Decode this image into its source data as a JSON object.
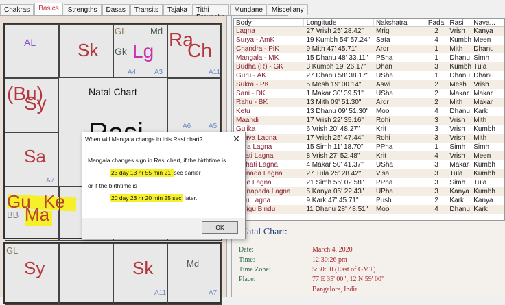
{
  "tabs": [
    "Chakras",
    "Basics",
    "Strengths",
    "Dasas",
    "Transits",
    "Tajaka",
    "Tithi Pravesha",
    "Mundane",
    "Miscellany"
  ],
  "selected_tab": "Basics",
  "rasi_chart": {
    "title": "Natal Chart",
    "name": "Rasi",
    "cells": {
      "r0c0": {
        "AL": "AL"
      },
      "r0c1": {
        "Sk": "Sk"
      },
      "r0c2": {
        "GL": "GL",
        "Md": "Md",
        "Gk": "Gk",
        "Lg": "Lg",
        "A4": "A4",
        "A3": "A3"
      },
      "r0c3": {
        "Ra": "Ra",
        "Ch": "Ch",
        "A11": "A11"
      },
      "r1c0": {
        "Bu": "(Bu)",
        "Sy": "Sy"
      },
      "r1c3": {
        "A6": "A6",
        "A5": "A5"
      },
      "r2c0": {
        "Sa": "Sa",
        "A7": "A7"
      },
      "r3c0": {
        "Gu": "Gu",
        "Ke": "Ke",
        "Ma": "Ma",
        "BB": "BB"
      }
    }
  },
  "second_chart": {
    "GL": "GL",
    "Sy": "Sy",
    "Sk": "Sk",
    "Md": "Md",
    "A11": "A11",
    "A7": "A7"
  },
  "table": {
    "headers": [
      "Body",
      "Longitude",
      "Nakshatra",
      "Pada",
      "Rasi",
      "Nava..."
    ],
    "rows": [
      [
        "Lagna",
        "27 Vrish 25' 28.42\"",
        "Mrig",
        "2",
        "Vrish",
        "Kanya"
      ],
      [
        "Surya - AmK",
        "19 Kumbh 54' 57.24\"",
        "Sata",
        "4",
        "Kumbh",
        "Meen"
      ],
      [
        "Chandra - PiK",
        "9 Mith 47' 45.71\"",
        "Ardr",
        "1",
        "Mith",
        "Dhanu"
      ],
      [
        "Mangala - MK",
        "15 Dhanu 48' 33.11\"",
        "PSha",
        "1",
        "Dhanu",
        "Simh"
      ],
      [
        "Budha (R) - GK",
        "3 Kumbh 19' 26.17\"",
        "Dhan",
        "3",
        "Kumbh",
        "Tula"
      ],
      [
        "Guru - AK",
        "27 Dhanu 58' 38.17\"",
        "USha",
        "1",
        "Dhanu",
        "Dhanu"
      ],
      [
        "Sukra - PK",
        "5 Mesh 19' 00.14\"",
        "Aswi",
        "2",
        "Mesh",
        "Vrish"
      ],
      [
        "Sani - DK",
        "1 Makar 30' 39.51\"",
        "USha",
        "2",
        "Makar",
        "Makar"
      ],
      [
        "Rahu - BK",
        "13 Mith 09' 51.30\"",
        "Ardr",
        "2",
        "Mith",
        "Makar"
      ],
      [
        "Ketu",
        "13 Dhanu 09' 51.30\"",
        "Mool",
        "4",
        "Dhanu",
        "Kark"
      ],
      [
        "Maandi",
        "17 Vrish 22' 35.16\"",
        "Rohi",
        "3",
        "Vrish",
        "Mith"
      ],
      [
        "Gulika",
        "6 Vrish 20' 48.27\"",
        "Krit",
        "3",
        "Vrish",
        "Kumbh"
      ],
      [
        "Bhava Lagna",
        "17 Vrish 25' 47.44\"",
        "Rohi",
        "3",
        "Vrish",
        "Mith"
      ],
      [
        "Hora Lagna",
        "15 Simh 11' 18.70\"",
        "PPha",
        "1",
        "Simh",
        "Simh"
      ],
      [
        "Ghati Lagna",
        "8 Vrish 27' 52.48\"",
        "Krit",
        "4",
        "Vrish",
        "Meen"
      ],
      [
        "Vighati Lagna",
        "4 Makar 50' 41.37\"",
        "USha",
        "3",
        "Makar",
        "Kumbh"
      ],
      [
        "Varnada Lagna",
        "27 Tula 25' 28.42\"",
        "Visa",
        "3",
        "Tula",
        "Kumbh"
      ],
      [
        "Sree Lagna",
        "21 Simh 55' 02.58\"",
        "PPha",
        "3",
        "Simh",
        "Tula"
      ],
      [
        "Pranapada Lagna",
        "5 Kanya 05' 22.43\"",
        "UPha",
        "3",
        "Kanya",
        "Kumbh"
      ],
      [
        "Indu Lagna",
        "9 Kark 47' 45.71\"",
        "Push",
        "2",
        "Kark",
        "Kanya"
      ],
      [
        "Bhrigu Bindu",
        "11 Dhanu 28' 48.51\"",
        "Mool",
        "4",
        "Dhanu",
        "Kark"
      ]
    ]
  },
  "natal": {
    "title": "Natal Chart:",
    "labels": {
      "date": "Date:",
      "time": "Time:",
      "tz": "Time Zone:",
      "place": "Place:"
    },
    "values": {
      "date": "March 4, 2020",
      "time": "12:30:26 pm",
      "tz": "5:30:00 (East of GMT)",
      "coords": "77 E 35' 00\", 12 N 59' 00\"",
      "city": "Bangalore, India"
    }
  },
  "dialog": {
    "title": "When will Mangala change in this Rasi chart?",
    "close": "✕",
    "line1": "Mangala changes sign in Rasi chart, if the birthtime is",
    "earlier_hl": "23 day 13 hr 55 min 21 ",
    "earlier_rest": "sec earlier",
    "line3": "or if the birthtime is",
    "later_hl": "20 day 23 hr 20 min 25 sec",
    "later_rest": " later.",
    "ok": "OK"
  },
  "colors": {
    "planet": "#b5373e",
    "highlight": "#f5f02a",
    "accent_tab": "#c0303a"
  }
}
